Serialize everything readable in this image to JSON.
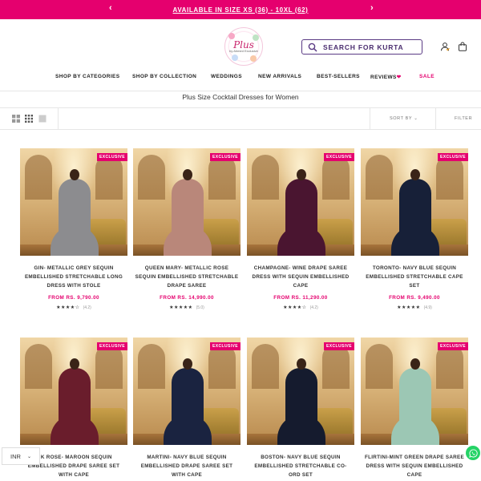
{
  "announcement": {
    "text": "AVAILABLE IN SIZE XS (36) - 10XL (62)",
    "prev": "‹",
    "next": "›"
  },
  "header": {
    "logo": {
      "main": "Plus",
      "sub": "by Ahmed Exclusive"
    },
    "search_label": "SEARCH FOR KURTA",
    "icons": [
      "search-icon",
      "user-icon",
      "bag-icon"
    ]
  },
  "nav": {
    "items": [
      {
        "label": "SHOP BY CATEGORIES"
      },
      {
        "label": "SHOP BY COLLECTION"
      },
      {
        "label": "WEDDINGS"
      },
      {
        "label": "NEW ARRIVALS"
      },
      {
        "label": "BEST-SELLERS"
      },
      {
        "label": "REVIEWS"
      },
      {
        "label": "SALE"
      }
    ],
    "reviews_heart": "❤"
  },
  "collection_title": "Plus Size Cocktail Dresses for Women",
  "toolbar": {
    "sort_label": "SORT BY",
    "sort_chevron": "⌄",
    "filter_label": "FILTER"
  },
  "products": [
    {
      "badge": "EXCLUSIVE",
      "name": "GIN- METALLIC GREY SEQUIN EMBELLISHED STRETCHABLE LONG DRESS WITH STOLE",
      "price": "FROM RS. 9,790.00",
      "stars": "★★★★☆",
      "reviews": "(4.2)",
      "dress": "#8c8c8f"
    },
    {
      "badge": "EXCLUSIVE",
      "name": "QUEEN MARY- METALLIC ROSE SEQUIN EMBELLISHED STRETCHABLE DRAPE SAREE",
      "price": "FROM RS. 14,990.00",
      "stars": "★★★★★",
      "reviews": "(5.0)",
      "dress": "#b9877a"
    },
    {
      "badge": "EXCLUSIVE",
      "name": "CHAMPAGNE- WINE DRAPE SAREE DRESS WITH SEQUIN EMBELLISHED CAPE",
      "price": "FROM RS. 11,290.00",
      "stars": "★★★★☆",
      "reviews": "(4.2)",
      "dress": "#4a1530"
    },
    {
      "badge": "EXCLUSIVE",
      "name": "TORONTO- NAVY BLUE SEQUIN EMBELLISHED STRETCHABLE CAPE SET",
      "price": "FROM RS. 9,490.00",
      "stars": "★★★★★",
      "reviews": "(4.9)",
      "dress": "#172038"
    },
    {
      "badge": "EXCLUSIVE",
      "name": "…K ROSE- MAROON SEQUIN EMBELLISHED DRAPE SAREE SET WITH CAPE",
      "price": "",
      "stars": "",
      "reviews": "",
      "dress": "#6a1d2c"
    },
    {
      "badge": "EXCLUSIVE",
      "name": "MARTINI- NAVY BLUE SEQUIN EMBELLISHED DRAPE SAREE SET WITH CAPE",
      "price": "",
      "stars": "",
      "reviews": "",
      "dress": "#1a2340"
    },
    {
      "badge": "EXCLUSIVE",
      "name": "BOSTON- NAVY BLUE SEQUIN EMBELLISHED STRETCHABLE CO-ORD SET",
      "price": "",
      "stars": "",
      "reviews": "",
      "dress": "#151b2e"
    },
    {
      "badge": "EXCLUSIVE",
      "name": "FLIRTINI-MINT GREEN DRAPE SAREE DRESS WITH SEQUIN EMBELLISHED CAPE",
      "price": "",
      "stars": "",
      "reviews": "",
      "dress": "#9cc7b4"
    }
  ],
  "currency": {
    "code": "INR",
    "chevron": "⌄"
  },
  "colors": {
    "brand": "#e5006e",
    "search_border": "#5a3a84",
    "whatsapp": "#25d366"
  }
}
